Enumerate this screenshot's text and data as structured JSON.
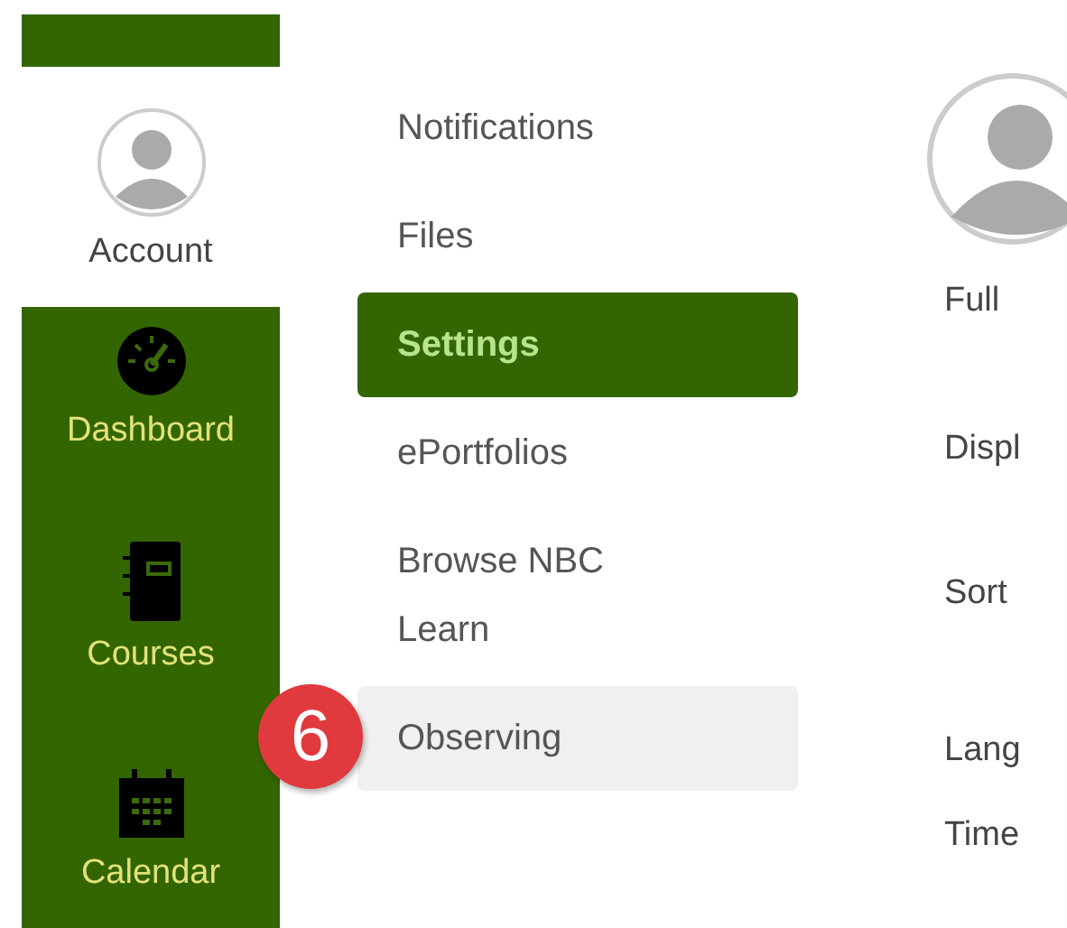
{
  "global_nav": [
    {
      "kind": "account",
      "label": "Account",
      "selected": true
    },
    {
      "kind": "dashboard",
      "label": "Dashboard",
      "selected": false
    },
    {
      "kind": "courses",
      "label": "Courses",
      "selected": false
    },
    {
      "kind": "calendar",
      "label": "Calendar",
      "selected": false
    }
  ],
  "sub_nav": [
    {
      "label": "Notifications",
      "selected": false,
      "hovered": false
    },
    {
      "label": "Files",
      "selected": false,
      "hovered": false
    },
    {
      "label": "Settings",
      "selected": true,
      "hovered": false
    },
    {
      "label": "ePortfolios",
      "selected": false,
      "hovered": false
    },
    {
      "label": "Browse NBC Learn",
      "selected": false,
      "hovered": false
    },
    {
      "label": "Observing",
      "selected": false,
      "hovered": true
    }
  ],
  "step_badge": "6",
  "profile_fields": [
    "Full",
    "Displ",
    "Sort",
    "Lang",
    "Time"
  ]
}
